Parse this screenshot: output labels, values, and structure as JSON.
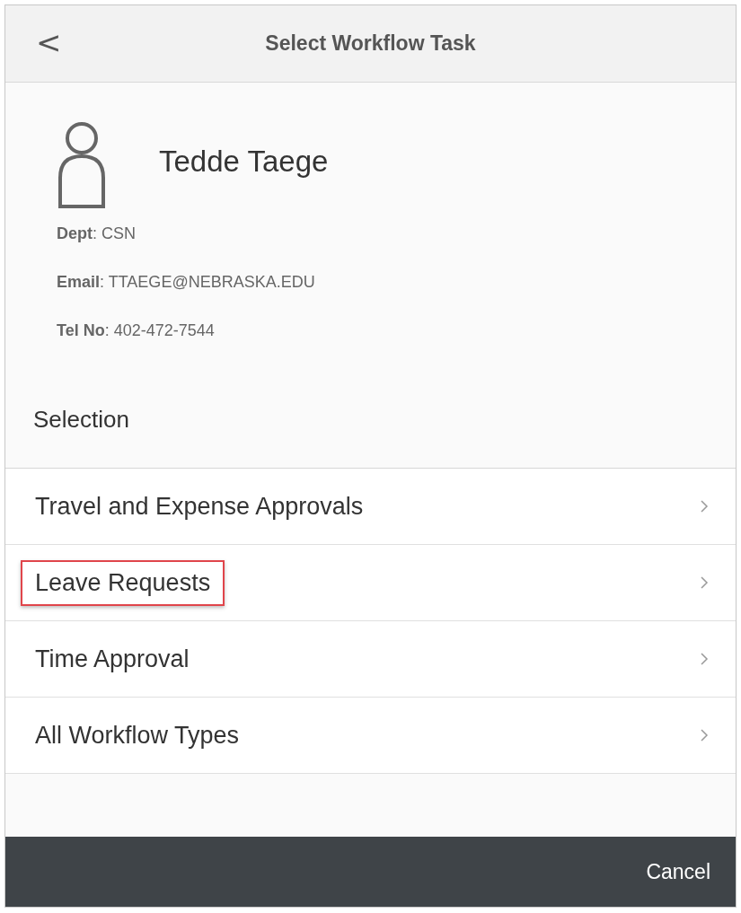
{
  "header": {
    "back": "<",
    "title": "Select Workflow Task"
  },
  "profile": {
    "name": "Tedde Taege",
    "fields": [
      {
        "label": "Dept",
        "value": ": CSN"
      },
      {
        "label": "Email",
        "value": ": TTAEGE@NEBRASKA.EDU"
      },
      {
        "label": "Tel No",
        "value": ": 402-472-7544"
      }
    ]
  },
  "section_title": "Selection",
  "items": [
    {
      "label": "Travel and Expense Approvals",
      "highlighted": false
    },
    {
      "label": "Leave Requests",
      "highlighted": true
    },
    {
      "label": "Time Approval",
      "highlighted": false
    },
    {
      "label": "All Workflow Types",
      "highlighted": false
    }
  ],
  "footer": {
    "cancel": "Cancel"
  }
}
